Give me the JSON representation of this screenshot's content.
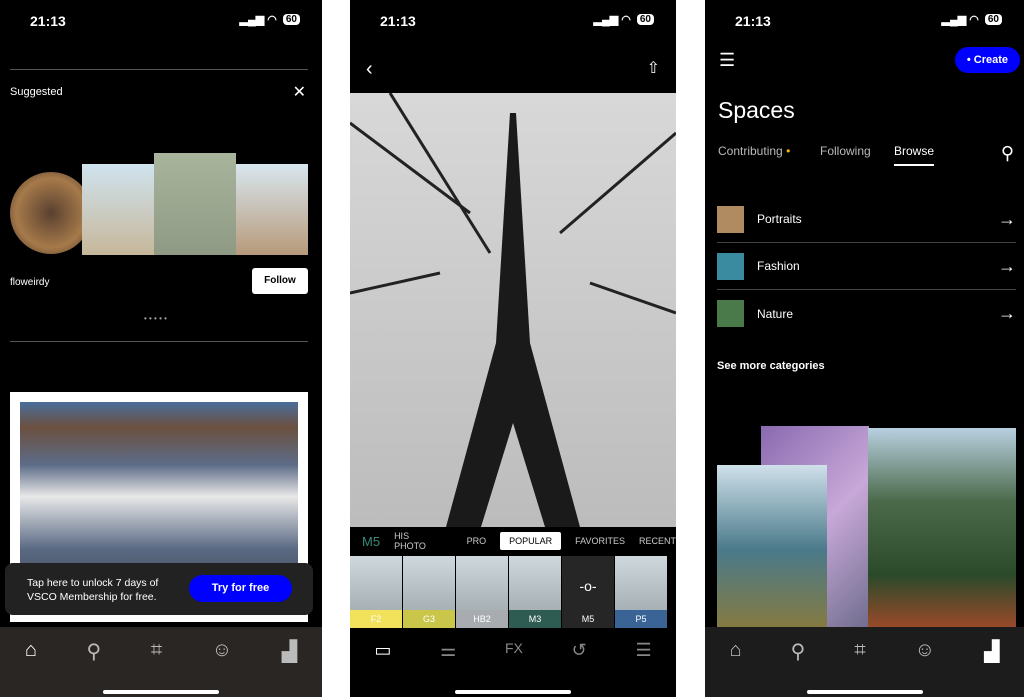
{
  "status": {
    "time": "21:13",
    "battery": "60"
  },
  "feed": {
    "suggested_label": "Suggested",
    "username": "floweirdy",
    "follow_label": "Follow",
    "promo_text_1": "Tap here to unlock 7 days of",
    "promo_text_2": "VSCO Membership for free.",
    "try_label": "Try for free",
    "tabs": [
      "home-icon",
      "search-icon",
      "crop-icon",
      "smiley-icon",
      "spaces-icon"
    ]
  },
  "editor": {
    "current_filter": "M5",
    "categories": [
      "HIS PHOTO",
      "PRO",
      "POPULAR",
      "FAVORITES",
      "RECENT"
    ],
    "active_category": "POPULAR",
    "presets": [
      {
        "name": "F2",
        "color": "#f2e15a"
      },
      {
        "name": "G3",
        "color": "#c9c64a"
      },
      {
        "name": "HB2",
        "color": "#a8abb0"
      },
      {
        "name": "M3",
        "color": "#2e5b52"
      },
      {
        "name": "M5",
        "color": "#262626"
      },
      {
        "name": "P5",
        "color": "#3a6496"
      }
    ],
    "tools": [
      "presets-icon",
      "adjust-icon",
      "fx-icon",
      "history-icon",
      "recipes-icon"
    ]
  },
  "spaces": {
    "create_label": "Create",
    "title": "Spaces",
    "tabs": [
      "Contributing",
      "Following",
      "Browse"
    ],
    "active_tab": "Browse",
    "accent": "#0000ff",
    "categories": [
      "Portraits",
      "Fashion",
      "Nature"
    ],
    "see_more": "See more categories"
  }
}
